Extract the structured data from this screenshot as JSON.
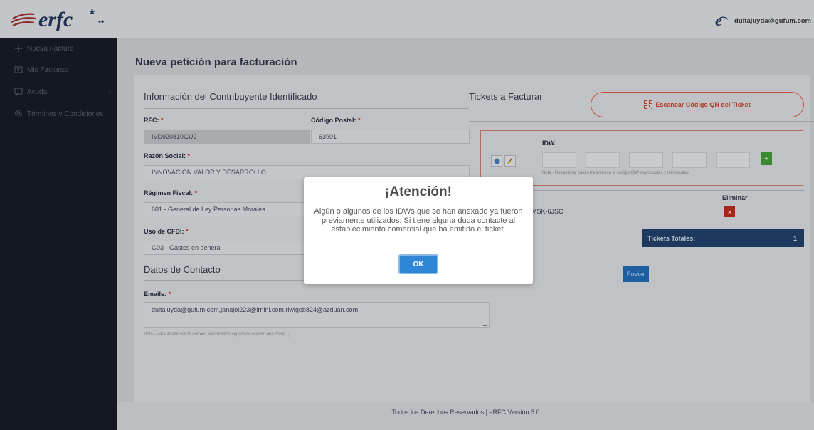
{
  "header": {
    "logo_text": "erfc*",
    "user_email": "dultajuyda@gufum.com"
  },
  "sidebar": {
    "items": [
      {
        "label": "Nueva Factura"
      },
      {
        "label": "Mis Facturas"
      },
      {
        "label": "Ayuda"
      },
      {
        "label": "Términos y Condiciones"
      }
    ]
  },
  "page": {
    "title": "Nueva petición para facturación"
  },
  "contribuyente": {
    "section_title": "Información del Contribuyente Identificado",
    "rfc_label": "RFC:",
    "rfc_value": "IVD920810GU2",
    "cp_label": "Código Postal:",
    "cp_value": "63901",
    "razon_label": "Razón Social:",
    "razon_value": "INNOVACION VALOR Y DESARROLLO",
    "regimen_label": "Régimen Fiscal:",
    "regimen_value": "601 - General de Ley Personas Morales",
    "uso_label": "Uso de CFDI:",
    "uso_value": "G03 - Gastos en general",
    "required_mark": "*"
  },
  "contacto": {
    "section_title": "Datos de Contacto",
    "emails_label": "Emails:",
    "emails_value": "dultajuyda@gufum.com,janajol223@irnini.com,riwigeb824@azduan.com",
    "note": "Nota - Para añadir varios correos electrónicos separelos usando una coma [,]"
  },
  "tickets": {
    "section_title": "Tickets a Facturar",
    "qr_button": "Escanear Código QR del Ticket",
    "idw_label": "IDW:",
    "idw_note": "Nota - Respete tal cual está impreso el código IDW mayúsculas y minúsculas",
    "add_button": "+",
    "col_eliminar": "Eliminar",
    "row_idw": "MSK-6JSC",
    "delete_button": "×",
    "totals_label": "Tickets Totales:",
    "totals_value": "1",
    "send_button": "Enviar"
  },
  "footer": {
    "text": "Todos los Derechos Reservados | eRFC Versión 5.0"
  },
  "modal": {
    "title": "¡Atención!",
    "message": "Algún o algunos de los IDWs que se han anexado ya fueron previamente utilizados. Si tiene alguna duda contacte al establecimiento comercial que ha emitido el ticket.",
    "ok_button": "OK"
  }
}
